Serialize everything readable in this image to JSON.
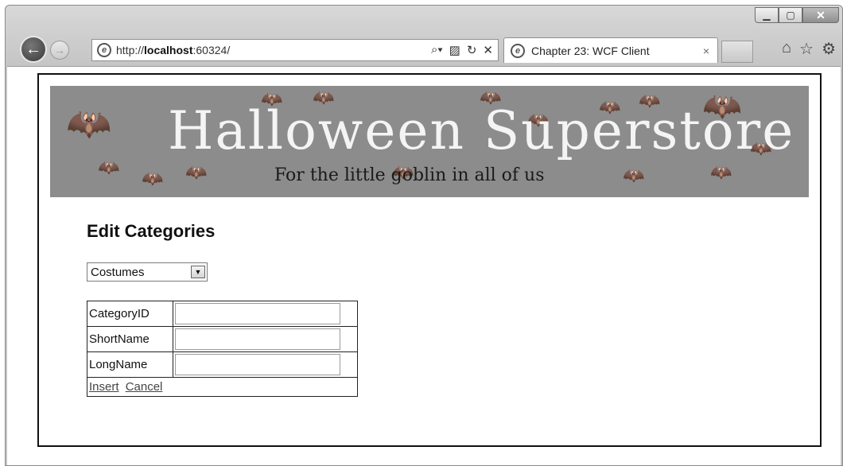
{
  "browser": {
    "url_prefix": "http://",
    "url_host": "localhost",
    "url_suffix": ":60324/",
    "tab_title": "Chapter 23: WCF Client",
    "tab_close": "×"
  },
  "banner": {
    "title": "Halloween Superstore",
    "subtitle": "For the little goblin in all of us"
  },
  "page": {
    "heading": "Edit Categories",
    "category_select": {
      "selected": "Costumes"
    },
    "form": {
      "fields": [
        {
          "label": "CategoryID",
          "value": ""
        },
        {
          "label": "ShortName",
          "value": ""
        },
        {
          "label": "LongName",
          "value": ""
        }
      ],
      "insert_label": "Insert",
      "cancel_label": "Cancel"
    }
  },
  "icons": {
    "back": "back-arrow-icon",
    "forward": "forward-arrow-icon",
    "search": "search-icon",
    "compat": "compatibility-view-icon",
    "refresh": "refresh-icon",
    "stop": "stop-icon",
    "home": "home-icon",
    "favorites": "star-icon",
    "tools": "gear-icon"
  }
}
